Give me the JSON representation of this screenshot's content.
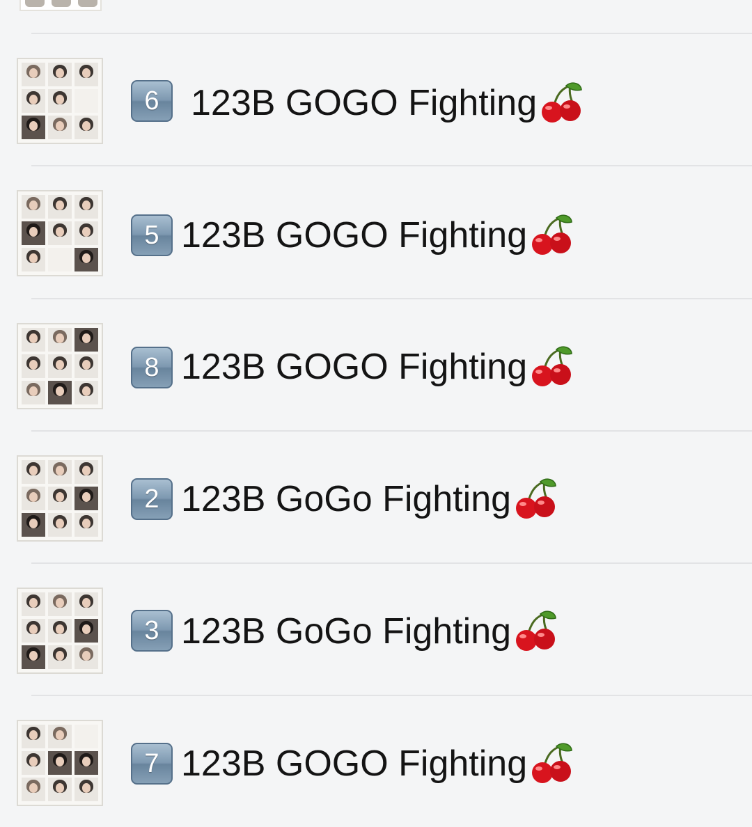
{
  "rows": [
    {
      "badge": "6",
      "name": "123B GOGO Fighting",
      "emoji": "cherries-icon"
    },
    {
      "badge": "5",
      "name": "123B GOGO Fighting",
      "emoji": "cherries-icon"
    },
    {
      "badge": "8",
      "name": "123B GOGO Fighting",
      "emoji": "cherries-icon"
    },
    {
      "badge": "2",
      "name": "123B GoGo Fighting",
      "emoji": "cherries-icon"
    },
    {
      "badge": "3",
      "name": "123B GoGo Fighting",
      "emoji": "cherries-icon"
    },
    {
      "badge": "7",
      "name": "123B GOGO Fighting",
      "emoji": "cherries-icon"
    }
  ],
  "colors": {
    "background": "#f4f5f6",
    "divider": "#e2e3e5",
    "badge": "#7d98b0",
    "cherry_red": "#d8141e",
    "leaf_green": "#4f9a2a"
  }
}
